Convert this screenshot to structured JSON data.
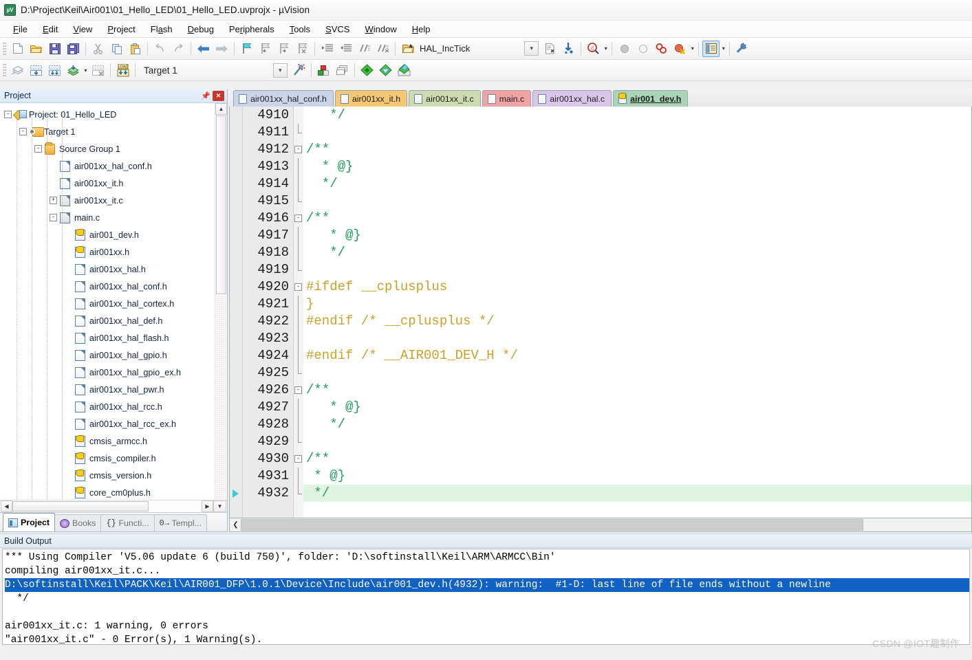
{
  "window": {
    "title": "D:\\Project\\Keil\\Air001\\01_Hello_LED\\01_Hello_LED.uvprojx - µVision",
    "app_icon": "uvision-icon"
  },
  "menu": {
    "items": [
      {
        "label": "File"
      },
      {
        "label": "Edit"
      },
      {
        "label": "View"
      },
      {
        "label": "Project"
      },
      {
        "label": "Flash"
      },
      {
        "label": "Debug"
      },
      {
        "label": "Peripherals"
      },
      {
        "label": "Tools"
      },
      {
        "label": "SVCS"
      },
      {
        "label": "Window"
      },
      {
        "label": "Help"
      }
    ]
  },
  "toolbar1": {
    "buttons": [
      {
        "name": "new-file-icon"
      },
      {
        "name": "open-file-icon"
      },
      {
        "name": "save-icon"
      },
      {
        "name": "save-all-icon"
      },
      {
        "name": "cut-icon"
      },
      {
        "name": "copy-icon"
      },
      {
        "name": "paste-icon"
      },
      {
        "name": "undo-icon"
      },
      {
        "name": "redo-icon"
      },
      {
        "name": "navigate-back-icon"
      },
      {
        "name": "navigate-forward-icon"
      },
      {
        "name": "toggle-bookmark-icon"
      },
      {
        "name": "previous-bookmark-icon"
      },
      {
        "name": "next-bookmark-icon"
      },
      {
        "name": "clear-bookmarks-icon"
      },
      {
        "name": "indent-icon"
      },
      {
        "name": "outdent-icon"
      },
      {
        "name": "comment-icon"
      },
      {
        "name": "uncomment-icon"
      },
      {
        "name": "open-folder-icon"
      }
    ],
    "function_name": "HAL_IncTick",
    "after": [
      {
        "name": "combo-dropdown-icon"
      },
      {
        "name": "insert-file-icon"
      },
      {
        "name": "goto-definition-icon"
      },
      {
        "name": "find-in-files-icon"
      },
      {
        "name": "find-dropdown-caret"
      },
      {
        "name": "breakpoint-disabled-icon"
      },
      {
        "name": "breakpoint-circle-icon"
      },
      {
        "name": "disable-all-breakpoints-icon"
      },
      {
        "name": "kill-all-breakpoints-icon"
      },
      {
        "name": "kill-dropdown-caret"
      },
      {
        "name": "project-window-icon"
      },
      {
        "name": "project-window-caret"
      },
      {
        "name": "configure-tools-icon"
      }
    ]
  },
  "toolbar2": {
    "buttons": [
      {
        "name": "translate-icon"
      },
      {
        "name": "build-icon"
      },
      {
        "name": "rebuild-icon"
      },
      {
        "name": "batch-build-icon"
      },
      {
        "name": "batch-build-caret"
      },
      {
        "name": "stop-build-icon"
      },
      {
        "name": "download-icon"
      }
    ],
    "target_value": "Target 1",
    "target_placeholder": "Target 1",
    "after": [
      {
        "name": "target-dropdown-icon"
      },
      {
        "name": "start-debug-icon"
      },
      {
        "name": "options-for-target-icon"
      },
      {
        "name": "manage-components-icon"
      },
      {
        "name": "pack-installer-icon"
      },
      {
        "name": "select-software-packs-icon"
      },
      {
        "name": "manage-run-time-icon"
      }
    ]
  },
  "project_panel": {
    "title": "Project",
    "pin_icon": "pin-icon",
    "close_icon": "close-icon",
    "tree": [
      {
        "label": "Project: 01_Hello_LED",
        "indent": 0,
        "expander": "-",
        "icon": "project-icon"
      },
      {
        "label": "Target 1",
        "indent": 1,
        "expander": "-",
        "icon": "target-icon"
      },
      {
        "label": "Source Group 1",
        "indent": 2,
        "expander": "-",
        "icon": "folder-icon"
      },
      {
        "label": "air001xx_hal_conf.h",
        "indent": 3,
        "expander": "",
        "icon": "file-icon"
      },
      {
        "label": "air001xx_it.h",
        "indent": 3,
        "expander": "",
        "icon": "file-icon"
      },
      {
        "label": "air001xx_it.c",
        "indent": 3,
        "expander": "+",
        "icon": "file-c-icon"
      },
      {
        "label": "main.c",
        "indent": 3,
        "expander": "-",
        "icon": "file-c-icon"
      },
      {
        "label": "air001_dev.h",
        "indent": 4,
        "expander": "",
        "icon": "key-file-icon"
      },
      {
        "label": "air001xx.h",
        "indent": 4,
        "expander": "",
        "icon": "key-file-icon"
      },
      {
        "label": "air001xx_hal.h",
        "indent": 4,
        "expander": "",
        "icon": "file-icon"
      },
      {
        "label": "air001xx_hal_conf.h",
        "indent": 4,
        "expander": "",
        "icon": "file-icon"
      },
      {
        "label": "air001xx_hal_cortex.h",
        "indent": 4,
        "expander": "",
        "icon": "file-icon"
      },
      {
        "label": "air001xx_hal_def.h",
        "indent": 4,
        "expander": "",
        "icon": "file-icon"
      },
      {
        "label": "air001xx_hal_flash.h",
        "indent": 4,
        "expander": "",
        "icon": "file-icon"
      },
      {
        "label": "air001xx_hal_gpio.h",
        "indent": 4,
        "expander": "",
        "icon": "file-icon"
      },
      {
        "label": "air001xx_hal_gpio_ex.h",
        "indent": 4,
        "expander": "",
        "icon": "file-icon"
      },
      {
        "label": "air001xx_hal_pwr.h",
        "indent": 4,
        "expander": "",
        "icon": "file-icon"
      },
      {
        "label": "air001xx_hal_rcc.h",
        "indent": 4,
        "expander": "",
        "icon": "file-icon"
      },
      {
        "label": "air001xx_hal_rcc_ex.h",
        "indent": 4,
        "expander": "",
        "icon": "file-icon"
      },
      {
        "label": "cmsis_armcc.h",
        "indent": 4,
        "expander": "",
        "icon": "key-file-icon"
      },
      {
        "label": "cmsis_compiler.h",
        "indent": 4,
        "expander": "",
        "icon": "key-file-icon"
      },
      {
        "label": "cmsis_version.h",
        "indent": 4,
        "expander": "",
        "icon": "key-file-icon"
      },
      {
        "label": "core_cm0plus.h",
        "indent": 4,
        "expander": "",
        "icon": "key-file-icon"
      }
    ],
    "tabs": [
      {
        "label": "Project",
        "icon": "project-window-icon",
        "selected": true
      },
      {
        "label": "Books",
        "icon": "books-icon",
        "selected": false
      },
      {
        "label": "Functi...",
        "icon": "functions-icon",
        "selected": false
      },
      {
        "label": "Templ...",
        "icon": "templates-icon",
        "selected": false
      }
    ]
  },
  "editor": {
    "tabs": [
      {
        "label": "air001xx_hal_conf.h",
        "color": "#ccd4ea",
        "icon": "file-icon",
        "selected": false
      },
      {
        "label": "air001xx_it.h",
        "color": "#f7c873",
        "icon": "file-icon",
        "selected": false
      },
      {
        "label": "air001xx_it.c",
        "color": "#cddbb0",
        "icon": "file-icon",
        "selected": false
      },
      {
        "label": "main.c",
        "color": "#efa3a3",
        "icon": "file-icon",
        "selected": false
      },
      {
        "label": "air001xx_hal.c",
        "color": "#d9c6e8",
        "icon": "file-icon",
        "selected": false
      },
      {
        "label": "air001_dev.h",
        "color": "#a9d4b6",
        "icon": "key-file-icon",
        "selected": true
      }
    ],
    "first_line_number": 4910,
    "current_line": 4932,
    "lines": [
      {
        "n": 4910,
        "text": "   */",
        "fold": "",
        "cls": "c-com"
      },
      {
        "n": 4911,
        "text": "",
        "fold": "end-top",
        "cls": ""
      },
      {
        "n": 4912,
        "text": "/**",
        "fold": "-",
        "cls": "c-com"
      },
      {
        "n": 4913,
        "text": "  * @}",
        "fold": "|",
        "cls": "c-com"
      },
      {
        "n": 4914,
        "text": "  */",
        "fold": "|",
        "cls": "c-com"
      },
      {
        "n": 4915,
        "text": "",
        "fold": "end",
        "cls": ""
      },
      {
        "n": 4916,
        "text": "/**",
        "fold": "-",
        "cls": "c-com"
      },
      {
        "n": 4917,
        "text": "   * @}",
        "fold": "|",
        "cls": "c-com"
      },
      {
        "n": 4918,
        "text": "   */",
        "fold": "|",
        "cls": "c-com"
      },
      {
        "n": 4919,
        "text": "",
        "fold": "end",
        "cls": ""
      },
      {
        "n": 4920,
        "text": "#ifdef __cplusplus",
        "fold": "-",
        "cls": "c-pp"
      },
      {
        "n": 4921,
        "text": "}",
        "fold": "|",
        "cls": "c-pp"
      },
      {
        "n": 4922,
        "text": "#endif /* __cplusplus */",
        "fold": "|",
        "cls": "c-pp"
      },
      {
        "n": 4923,
        "text": "",
        "fold": "|",
        "cls": ""
      },
      {
        "n": 4924,
        "text": "#endif /* __AIR001_DEV_H */",
        "fold": "|",
        "cls": "c-pp"
      },
      {
        "n": 4925,
        "text": "",
        "fold": "end",
        "cls": ""
      },
      {
        "n": 4926,
        "text": "/**",
        "fold": "-",
        "cls": "c-com"
      },
      {
        "n": 4927,
        "text": "   * @}",
        "fold": "|",
        "cls": "c-com"
      },
      {
        "n": 4928,
        "text": "   */",
        "fold": "|",
        "cls": "c-com"
      },
      {
        "n": 4929,
        "text": "",
        "fold": "end",
        "cls": ""
      },
      {
        "n": 4930,
        "text": "/**",
        "fold": "-",
        "cls": "c-com"
      },
      {
        "n": 4931,
        "text": " * @}",
        "fold": "|",
        "cls": "c-com"
      },
      {
        "n": 4932,
        "text": " */",
        "fold": "end",
        "cls": "c-com",
        "highlight": true
      }
    ]
  },
  "build_output": {
    "title": "Build Output",
    "lines": [
      {
        "text": "*** Using Compiler 'V5.06 update 6 (build 750)', folder: 'D:\\softinstall\\Keil\\ARM\\ARMCC\\Bin'",
        "selected": false
      },
      {
        "text": "compiling air001xx_it.c...",
        "selected": false
      },
      {
        "text": "D:\\softinstall\\Keil\\PACK\\Keil\\AIR001_DFP\\1.0.1\\Device\\Include\\air001_dev.h(4932): warning:  #1-D: last line of file ends without a newline",
        "selected": true
      },
      {
        "text": "  */",
        "selected": false
      },
      {
        "text": "",
        "selected": false
      },
      {
        "text": "air001xx_it.c: 1 warning, 0 errors",
        "selected": false
      },
      {
        "text": "\"air001xx_it.c\" - 0 Error(s), 1 Warning(s).",
        "selected": false
      }
    ]
  },
  "watermark": "CSDN @IOT趣制作",
  "colors": {
    "accent": "#1061c4",
    "highlight_line": "#dff5e2",
    "comment_green": "#1f9d5b",
    "preproc_yellow": "#c9a227",
    "at_orange": "#c0694a",
    "close_red": "#c8372d"
  }
}
